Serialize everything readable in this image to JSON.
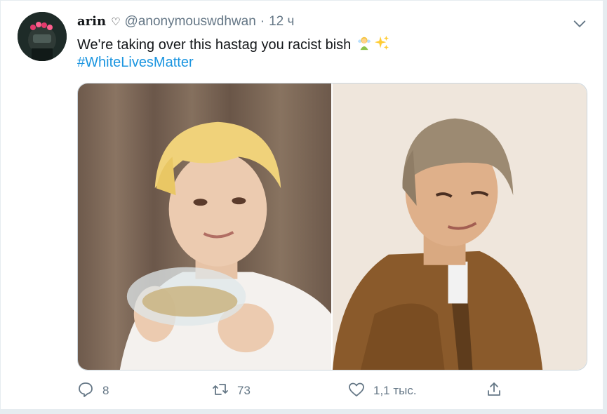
{
  "tweet": {
    "author_name": "arin",
    "name_icon": "heart-outline-icon",
    "handle": "@anonymouswdhwan",
    "separator": "·",
    "time": "12 ч",
    "text": "We're taking over this hastag you racist bish",
    "emojis": [
      "fairy-emoji",
      "sparkles-emoji"
    ],
    "hashtag": "#WhiteLivesMatter",
    "media": [
      {
        "name": "photo-left",
        "description_icon": "photo"
      },
      {
        "name": "photo-right",
        "description_icon": "photo"
      }
    ]
  },
  "actions": {
    "reply_count": "8",
    "retweet_count": "73",
    "like_count": "1,1 тыс.",
    "share_label": ""
  },
  "colors": {
    "link": "#1b95e0",
    "secondary": "#657786",
    "primary": "#14171a"
  }
}
